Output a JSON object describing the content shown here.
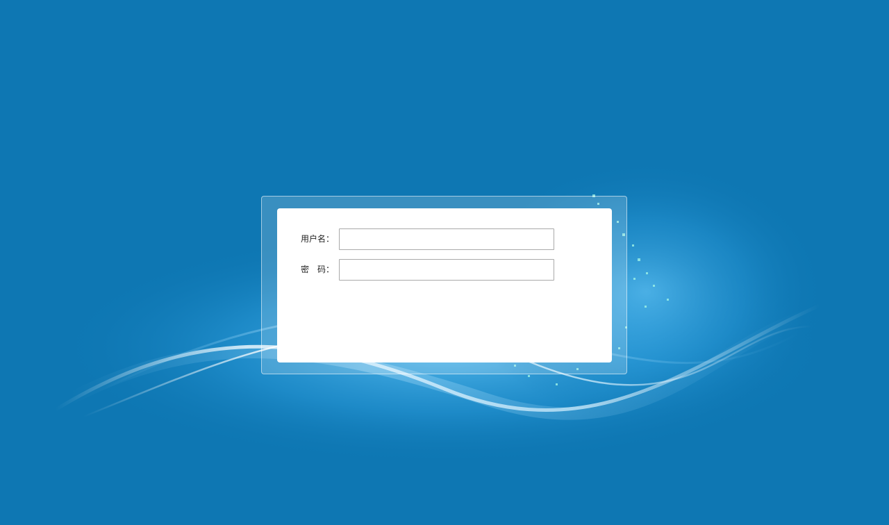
{
  "login": {
    "username_label": "用户名：",
    "password_label": "密　码：",
    "username_value": "",
    "password_value": ""
  },
  "theme": {
    "background": "#0e77b3",
    "panel": "#ffffff",
    "input_border": "#a9a9a9"
  }
}
